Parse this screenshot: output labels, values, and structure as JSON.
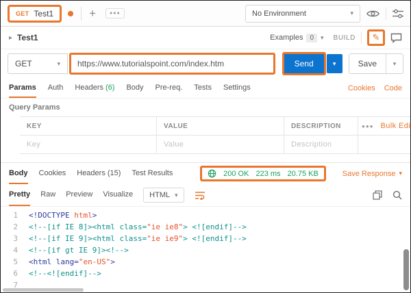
{
  "colors": {
    "accent_orange": "#e8762c",
    "send_blue": "#0c74cf",
    "success_green": "#18a05c"
  },
  "icons": {
    "caret": "▾",
    "disclosure": "▸",
    "pencil": "✎"
  },
  "topbar": {
    "tab": {
      "method": "GET",
      "title": "Test1"
    },
    "new_tab_label": "+",
    "more_label": "●●●",
    "environment": "No Environment"
  },
  "title_row": {
    "request_title": "Test1",
    "examples_label": "Examples",
    "examples_count": "0",
    "build_label": "BUILD"
  },
  "url_row": {
    "method": "GET",
    "url": "https://www.tutorialspoint.com/index.htm",
    "send_label": "Send",
    "save_label": "Save"
  },
  "request_tabs": {
    "params": "Params",
    "auth": "Auth",
    "headers": "Headers",
    "headers_count": "(6)",
    "body": "Body",
    "prereq": "Pre-req.",
    "tests": "Tests",
    "settings": "Settings",
    "cookies_link": "Cookies",
    "code_link": "Code"
  },
  "query_params": {
    "title": "Query Params",
    "col_key": "KEY",
    "col_value": "VALUE",
    "col_description": "DESCRIPTION",
    "more_label": "●●●",
    "bulk_edit_label": "Bulk Edit",
    "placeholder_key": "Key",
    "placeholder_value": "Value",
    "placeholder_description": "Description"
  },
  "response": {
    "tabs": {
      "body": "Body",
      "cookies": "Cookies",
      "headers": "Headers (15)",
      "test_results": "Test Results"
    },
    "status": "200 OK",
    "time": "223 ms",
    "size": "20.75 KB",
    "save_response_label": "Save Response",
    "view_modes": {
      "pretty": "Pretty",
      "raw": "Raw",
      "preview": "Preview",
      "visualize": "Visualize"
    },
    "format": "HTML",
    "code": {
      "lines": [
        {
          "num": "1",
          "segments": [
            {
              "t": "<!DOCTYPE ",
              "c": "tag"
            },
            {
              "t": "html",
              "c": "str"
            },
            {
              "t": ">",
              "c": "tag"
            }
          ]
        },
        {
          "num": "2",
          "segments": [
            {
              "t": "<!--[if IE 8]><html class=",
              "c": "com"
            },
            {
              "t": "\"ie ie8\"",
              "c": "str"
            },
            {
              "t": "> <![endif]-->",
              "c": "com"
            }
          ]
        },
        {
          "num": "3",
          "segments": [
            {
              "t": "<!--[if IE 9]><html class=",
              "c": "com"
            },
            {
              "t": "\"ie ie9\"",
              "c": "str"
            },
            {
              "t": "> <![endif]-->",
              "c": "com"
            }
          ]
        },
        {
          "num": "4",
          "segments": [
            {
              "t": "<!--[if gt IE 9]><!-->",
              "c": "com"
            }
          ]
        },
        {
          "num": "5",
          "segments": [
            {
              "t": "<html lang=",
              "c": "tag"
            },
            {
              "t": "\"en-US\"",
              "c": "str"
            },
            {
              "t": ">",
              "c": "tag"
            }
          ]
        },
        {
          "num": "6",
          "segments": [
            {
              "t": "<!--<![endif]-->",
              "c": "com"
            }
          ]
        },
        {
          "num": "7",
          "segments": []
        }
      ]
    }
  }
}
